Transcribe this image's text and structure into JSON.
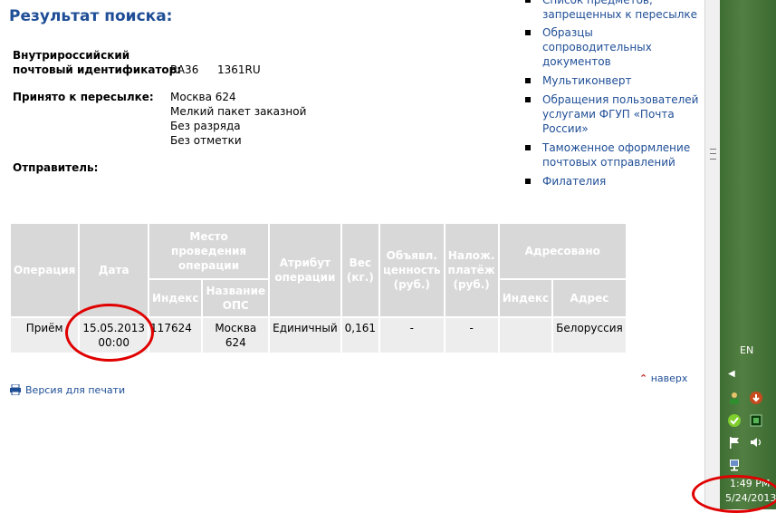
{
  "page_title": "Результат поиска:",
  "info": {
    "id_label_1": "Внутрироссийский",
    "id_label_2": "почтовый идентификатор:",
    "id_value_1": "RA36",
    "id_value_2": "1361RU",
    "accepted_label": "Принято к пересылке:",
    "accepted_lines": [
      "Москва 624",
      "Мелкий пакет заказной",
      "Без разряда",
      "Без отметки"
    ],
    "sender_label": "Отправитель:"
  },
  "right_links": [
    {
      "lines": [
        "Список предметов,",
        "запрещенных к пересылке"
      ]
    },
    {
      "lines": [
        "Образцы",
        "сопроводительных",
        "документов"
      ]
    },
    {
      "lines": [
        "Мультиконверт"
      ]
    },
    {
      "lines": [
        "Обращения пользователей",
        "услугами ФГУП «Почта",
        "России»"
      ]
    },
    {
      "lines": [
        "Таможенное оформление",
        "почтовых отправлений"
      ]
    },
    {
      "lines": [
        "Филателия"
      ]
    }
  ],
  "table": {
    "headers": {
      "operation": "Операция",
      "date": "Дата",
      "place": "Место проведения операции",
      "place_index": "Индекс",
      "place_name": "Название ОПС",
      "attribute": "Атрибут операции",
      "weight": "Вес (кг.)",
      "declared": "Объявл. ценность (руб.)",
      "cod": "Налож. платёж (руб.)",
      "addressed": "Адресовано",
      "addr_index": "Индекс",
      "addr_address": "Адрес"
    },
    "row": {
      "operation": "Приём",
      "date_1": "15.05.2013",
      "date_2": "00:00",
      "index": "117624",
      "ops_1": "Москва",
      "ops_2": "624",
      "attribute": "Единичный",
      "weight": "0,161",
      "declared": "-",
      "cod": "-",
      "addr_index": "",
      "addr_address": "Белоруссия"
    }
  },
  "links": {
    "print": "Версия для печати",
    "up": "наверх"
  },
  "taskbar": {
    "lang": "EN",
    "time": "1:49 PM",
    "date": "5/24/2013"
  },
  "colors": {
    "link": "#1f4e96",
    "header_bg": "#d8d8d8",
    "cell_bg": "#ededed",
    "annotation": "#e00000",
    "taskbar": "#4a7a3c"
  }
}
